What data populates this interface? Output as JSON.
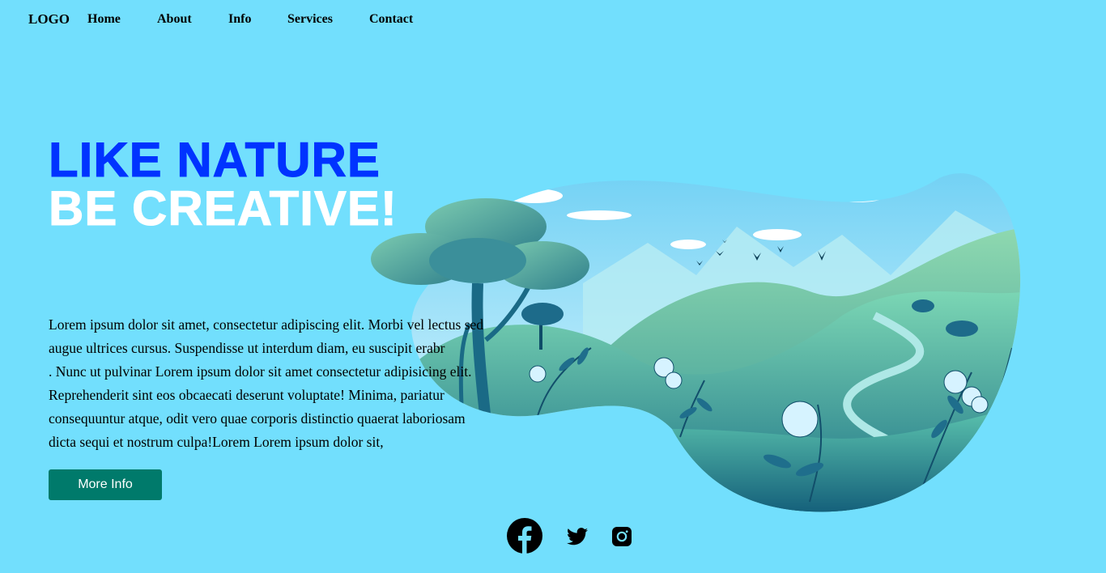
{
  "nav": {
    "logo": "LOGO",
    "items": [
      {
        "label": "Home"
      },
      {
        "label": "About"
      },
      {
        "label": "Info"
      },
      {
        "label": "Services"
      },
      {
        "label": "Contact"
      }
    ]
  },
  "hero": {
    "headline_line1": "LIKE NATURE",
    "headline_line2": "BE CREATIVE!",
    "paragraph_lines": [
      "Lorem ipsum dolor sit amet, consectetur adipiscing elit. Morbi vel lectus sed",
      "augue ultrices cursus. Suspendisse ut interdum diam, eu suscipit erabr",
      ". Nunc ut pulvinar Lorem ipsum dolor sit amet consectetur adipisicing elit.",
      "Reprehenderit sint eos obcaecati deserunt voluptate! Minima, pariatur",
      "consequuntur atque, odit vero quae corporis distinctio quaerat laboriosam",
      "dicta sequi et nostrum culpa!Lorem Lorem ipsum dolor sit,"
    ],
    "button_label": "More Info"
  },
  "illustration": {
    "icon": "nature-landscape-illustration"
  },
  "social": {
    "icons": [
      "facebook-icon",
      "twitter-icon",
      "instagram-icon"
    ]
  },
  "colors": {
    "background": "#72dffd",
    "headline_primary": "#0033ff",
    "headline_secondary": "#ffffff",
    "button": "#007a6b"
  }
}
